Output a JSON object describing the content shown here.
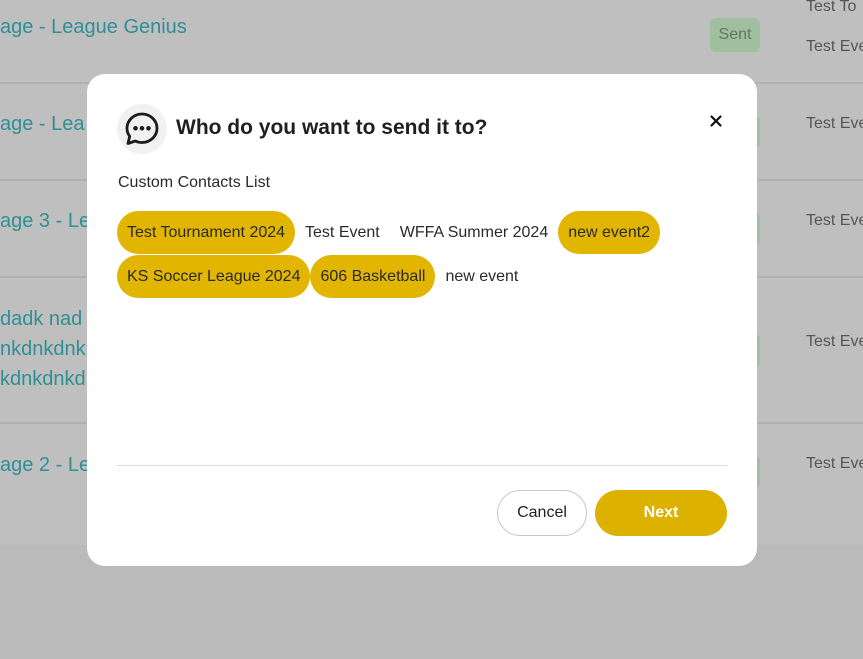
{
  "background": {
    "rows": [
      {
        "title_lines": [
          "age - League Genius"
        ],
        "badge": "Sent",
        "events": [
          "Test To",
          "Test Eve"
        ]
      },
      {
        "title_lines": [
          "age - Lea"
        ],
        "badge": "",
        "events": [
          "Test Eve"
        ]
      },
      {
        "title_lines": [
          "age 3 - Le"
        ],
        "badge": "",
        "events": [
          "Test Eve"
        ]
      },
      {
        "title_lines": [
          "dadk nad",
          "nkdnkdnk",
          "kdnkdnkd"
        ],
        "badge": "",
        "events": [
          "Test Eve"
        ]
      },
      {
        "title_lines": [
          "age 2 - Le"
        ],
        "badge": "",
        "events": [
          "Test Eve"
        ]
      }
    ]
  },
  "modal": {
    "title": "Who do you want to send it to?",
    "icon": "chat-bubble-icon",
    "close_icon": "close-icon",
    "list_label": "Custom Contacts List",
    "contacts": [
      {
        "label": "Test Tournament 2024",
        "selected": true
      },
      {
        "label": "Test Event",
        "selected": false
      },
      {
        "label": "WFFA Summer 2024",
        "selected": false
      },
      {
        "label": "new event2",
        "selected": true
      },
      {
        "label": "KS Soccer League 2024",
        "selected": true
      },
      {
        "label": "606 Basketball",
        "selected": true
      },
      {
        "label": "new event",
        "selected": false
      }
    ],
    "cancel_label": "Cancel",
    "next_label": "Next"
  },
  "colors": {
    "accent": "#E2B500",
    "overlay": "#BFBFBF",
    "title_link": "#2F8F95"
  }
}
